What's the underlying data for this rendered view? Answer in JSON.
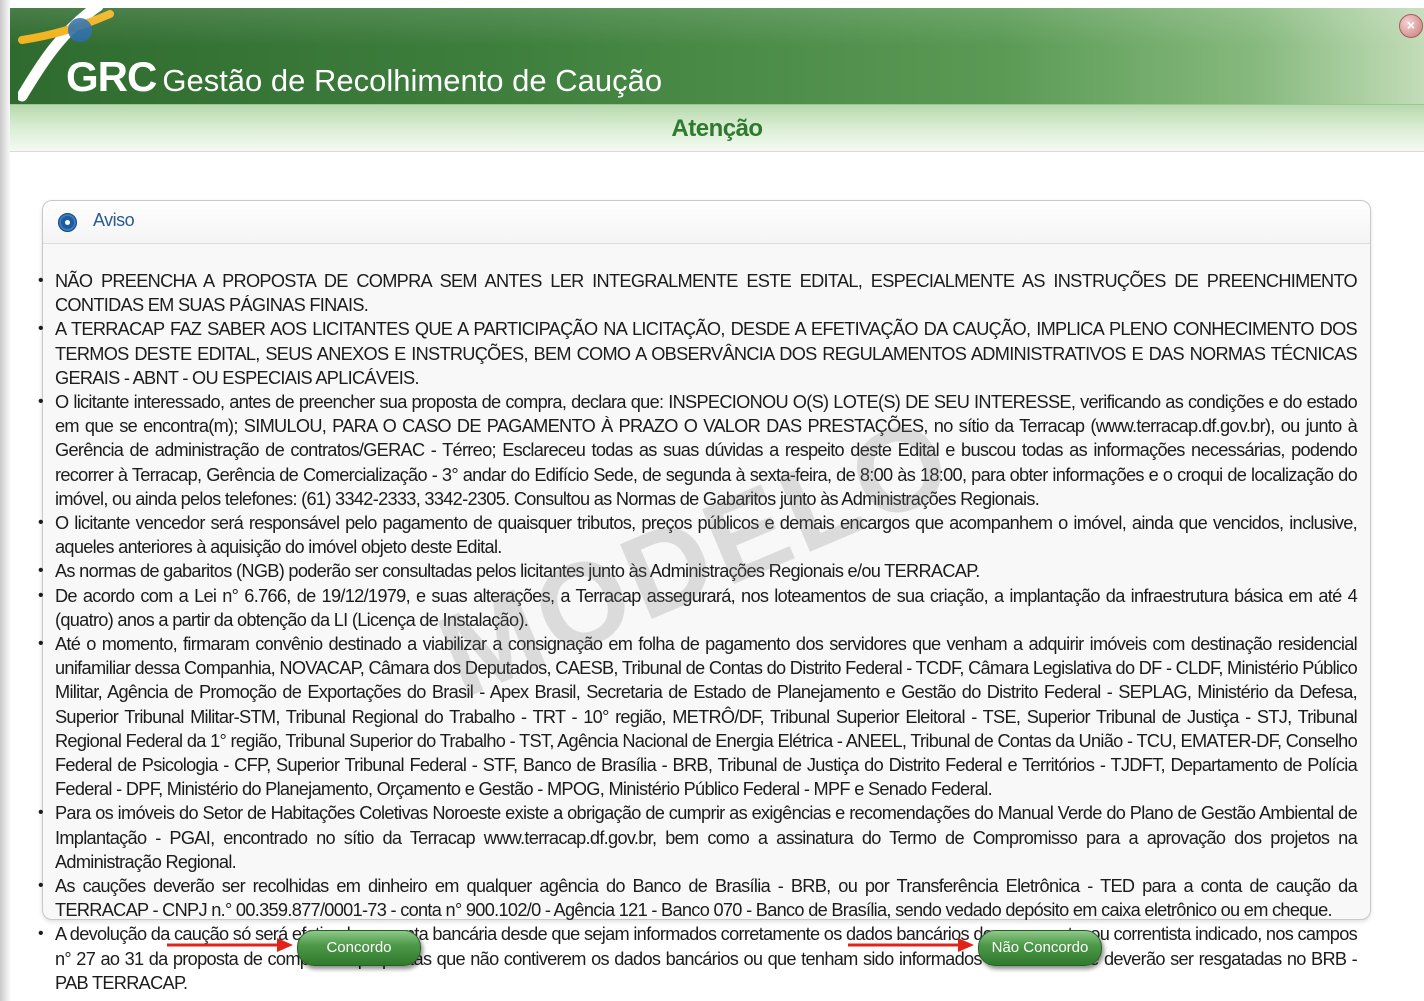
{
  "header": {
    "abbr": "GRC",
    "app_name": "Gestão de Recolhimento de Caução",
    "close_label": "×"
  },
  "page_title": "Atenção",
  "panel": {
    "title": "Aviso",
    "items": [
      "NÃO PREENCHA A PROPOSTA DE COMPRA SEM ANTES LER INTEGRALMENTE ESTE EDITAL, ESPECIALMENTE AS INSTRUÇÕES DE PREENCHIMENTO CONTIDAS EM SUAS PÁGINAS FINAIS.",
      "A TERRACAP FAZ SABER AOS LICITANTES QUE A PARTICIPAÇÃO NA LICITAÇÃO, DESDE A EFETIVAÇÃO DA CAUÇÃO, IMPLICA PLENO CONHECIMENTO DOS TERMOS DESTE EDITAL, SEUS ANEXOS E INSTRUÇÕES, BEM COMO A OBSERVÂNCIA DOS REGULAMENTOS ADMINISTRATIVOS E DAS NORMAS TÉCNICAS GERAIS - ABNT - OU ESPECIAIS APLICÁVEIS.",
      "O licitante interessado, antes de preencher sua proposta de compra, declara que: INSPECIONOU O(S) LOTE(S) DE SEU INTERESSE, verificando as condições e do estado em que se encontra(m); SIMULOU, PARA O CASO DE PAGAMENTO À PRAZO O VALOR DAS PRESTAÇÕES, no sítio da Terracap (www.terracap.df.gov.br), ou junto à Gerência de administração de contratos/GERAC - Térreo; Esclareceu todas as suas dúvidas a respeito deste Edital e buscou todas as informações necessárias, podendo recorrer à Terracap, Gerência de Comercialização - 3° andar do Edifício Sede, de segunda à sexta-feira, de 8:00 às 18:00, para obter informações e o croqui de localização do imóvel, ou ainda pelos telefones: (61) 3342-2333, 3342-2305. Consultou as Normas de Gabaritos junto às Administrações Regionais.",
      "O licitante vencedor será responsável pelo pagamento de quaisquer tributos, preços públicos e demais encargos que acompanhem o imóvel, ainda que vencidos, inclusive, aqueles anteriores à aquisição do imóvel objeto deste Edital.",
      "As normas de gabaritos (NGB) poderão ser consultadas pelos licitantes junto às Administrações Regionais e/ou TERRACAP.",
      "De acordo com a Lei n° 6.766, de 19/12/1979, e suas alterações, a Terracap assegurará, nos loteamentos de sua criação, a implantação da infraestrutura básica em até 4 (quatro) anos a partir da obtenção da LI (Licença de Instalação).",
      "Até o momento, firmaram convênio destinado a viabilizar a consignação em folha de pagamento dos servidores que venham a adquirir imóveis com destinação residencial unifamiliar dessa Companhia, NOVACAP, Câmara dos Deputados, CAESB, Tribunal de Contas do Distrito Federal - TCDF, Câmara Legislativa do DF - CLDF, Ministério Público Militar, Agência de Promoção de Exportações do Brasil - Apex Brasil, Secretaria de Estado de Planejamento e Gestão do Distrito Federal - SEPLAG, Ministério da Defesa, Superior Tribunal Militar-STM, Tribunal Regional do Trabalho - TRT - 10° região, METRÔ/DF, Tribunal Superior Eleitoral - TSE, Superior Tribunal de Justiça - STJ, Tribunal Regional Federal da 1° região, Tribunal Superior do Trabalho - TST, Agência Nacional de Energia Elétrica - ANEEL, Tribunal de Contas da União - TCU, EMATER-DF, Conselho Federal de Psicologia - CFP, Superior Tribunal Federal - STF, Banco de Brasília - BRB, Tribunal de Justiça do Distrito Federal e Territórios - TJDFT, Departamento de Polícia Federal - DPF, Ministério do Planejamento, Orçamento e Gestão - MPOG, Ministério Público Federal - MPF e Senado Federal.",
      "Para os imóveis do Setor de Habitações Coletivas Noroeste existe a obrigação de cumprir as exigências e recomendações do Manual Verde do Plano de Gestão Ambiental de Implantação - PGAI, encontrado no sítio da Terracap www.terracap.df.gov.br, bem como a assinatura do Termo de Compromisso para a aprovação dos projetos na Administração Regional.",
      "As cauções deverão ser recolhidas em dinheiro em qualquer agência do Banco de Brasília - BRB, ou por Transferência Eletrônica - TED para a conta de caução da TERRACAP - CNPJ n.° 00.359.877/0001-73 - conta n° 900.102/0 - Agência 121 - Banco 070 - Banco de Brasília, sendo vedado depósito em caixa eletrônico ou em cheque.",
      "A devolução da caução só será efetivada na conta bancária desde que sejam informados corretamente os dados bancários do proponente, ou correntista indicado, nos campos n° 27 ao 31 da proposta de compra. As propostas que não contiverem os dados bancários ou que tenham sido informados incorretamente deverão ser resgatadas no BRB -PAB TERRACAP."
    ]
  },
  "watermark": "MODELO",
  "buttons": {
    "agree": "Concordo",
    "disagree": "Não Concordo"
  },
  "colors": {
    "header_green": "#3e7f3d",
    "title_green": "#2f7a2f",
    "button_green": "#4e9a4a",
    "arrow_red": "#e0241c",
    "info_blue": "#1f5c9c"
  },
  "icons": [
    "grc-logo-icon",
    "close-icon",
    "info-icon",
    "arrow-right-icon"
  ]
}
